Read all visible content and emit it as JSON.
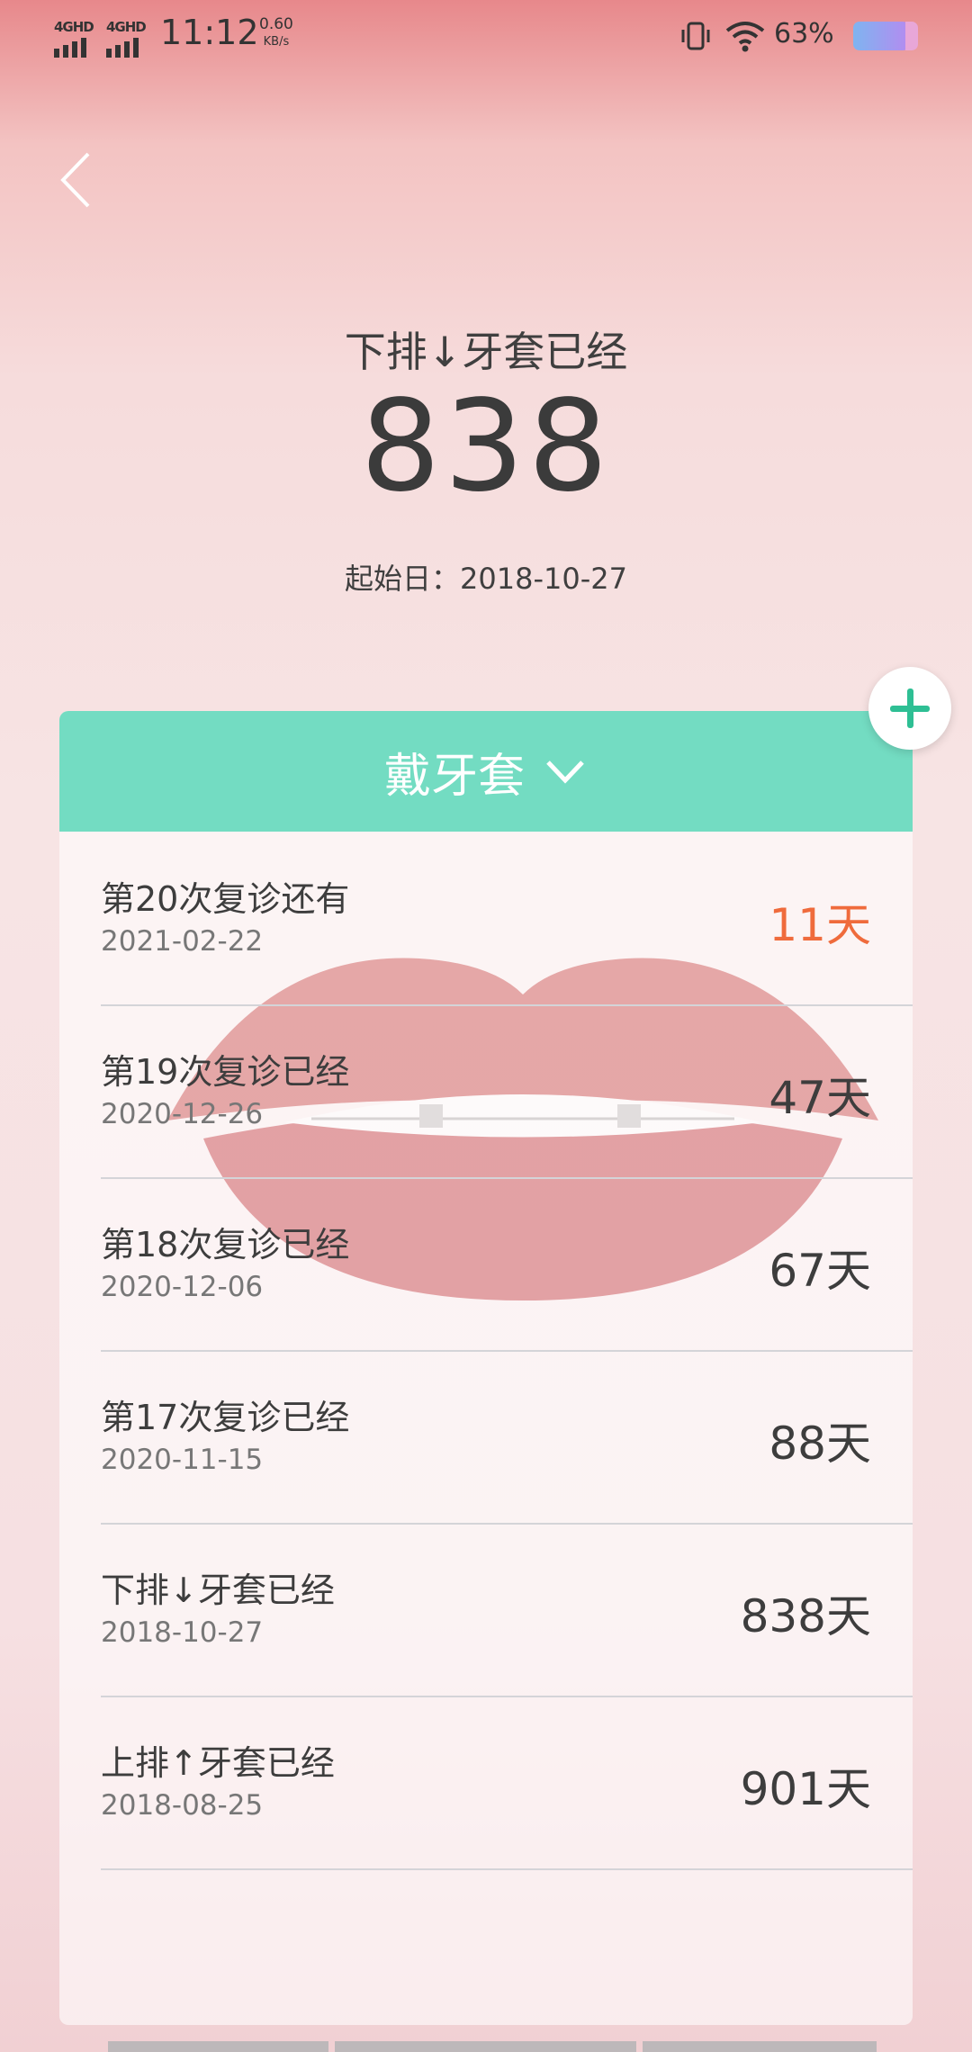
{
  "status_bar": {
    "network1": "4GHD",
    "network2": "4GHD",
    "time": "11:12",
    "speed_value": "0.60",
    "speed_unit": "KB/s",
    "battery_percent": "63%"
  },
  "hero": {
    "title": "下排↓牙套已经",
    "count": "838",
    "start_date": "起始日：2018-10-27"
  },
  "card": {
    "header": "戴牙套",
    "rows": [
      {
        "label": "第20次复诊还有",
        "date": "2021-02-22",
        "days": "11天",
        "highlight": true
      },
      {
        "label": "第19次复诊已经",
        "date": "2020-12-26",
        "days": "47天"
      },
      {
        "label": "第18次复诊已经",
        "date": "2020-12-06",
        "days": "67天"
      },
      {
        "label": "第17次复诊已经",
        "date": "2020-11-15",
        "days": "88天"
      },
      {
        "label": "下排↓牙套已经",
        "date": "2018-10-27",
        "days": "838天"
      },
      {
        "label": "上排↑牙套已经",
        "date": "2018-08-25",
        "days": "901天"
      }
    ]
  },
  "colors": {
    "accent": "#73dcc2",
    "highlight": "#ef6b3c",
    "add_plus": "#2ebf94"
  }
}
